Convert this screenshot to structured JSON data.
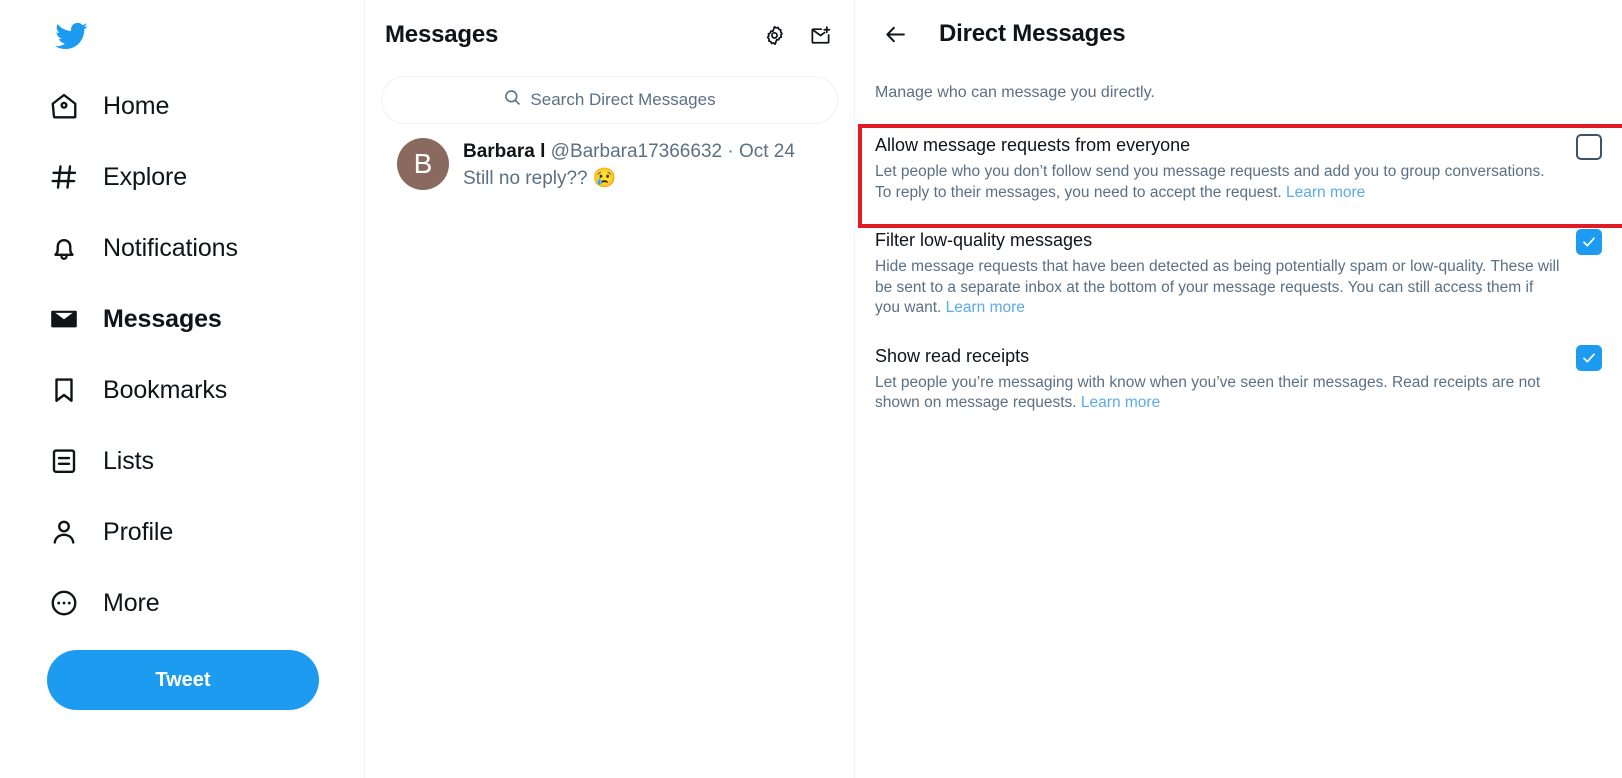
{
  "sidebar": {
    "logo_icon": "twitter-bird-logo",
    "items": [
      {
        "label": "Home",
        "icon": "home-icon",
        "active": false
      },
      {
        "label": "Explore",
        "icon": "hashtag-icon",
        "active": false
      },
      {
        "label": "Notifications",
        "icon": "bell-icon",
        "active": false
      },
      {
        "label": "Messages",
        "icon": "envelope-icon",
        "active": true
      },
      {
        "label": "Bookmarks",
        "icon": "bookmark-icon",
        "active": false
      },
      {
        "label": "Lists",
        "icon": "list-icon",
        "active": false
      },
      {
        "label": "Profile",
        "icon": "person-icon",
        "active": false
      },
      {
        "label": "More",
        "icon": "more-circle-icon",
        "active": false
      }
    ],
    "tweet_button": "Tweet"
  },
  "messages_column": {
    "title": "Messages",
    "settings_icon": "gear-icon",
    "new_message_icon": "new-message-icon",
    "search": {
      "icon": "search-icon",
      "placeholder": "Search Direct Messages",
      "value": ""
    },
    "conversations": [
      {
        "avatar_initial": "B",
        "avatar_color": "#8a6a5e",
        "name": "Barbara l",
        "handle": "@Barbara17366632",
        "separator": "·",
        "date": "Oct 24",
        "preview": "Still no reply?? 😢"
      }
    ]
  },
  "settings_panel": {
    "back_icon": "back-arrow-icon",
    "title": "Direct Messages",
    "subtitle": "Manage who can message you directly.",
    "learn_more_label": "Learn more",
    "settings": [
      {
        "label": "Allow message requests from everyone",
        "description": "Let people who you don’t follow send you message requests and add you to group conversations. To reply to their messages, you need to accept the request. ",
        "checked": false,
        "highlighted": true
      },
      {
        "label": "Filter low-quality messages",
        "description": "Hide message requests that have been detected as being potentially spam or low-quality. These will be sent to a separate inbox at the bottom of your message requests. You can still access them if you want. ",
        "checked": true,
        "highlighted": false
      },
      {
        "label": "Show read receipts",
        "description": "Let people you’re messaging with know when you’ve seen their messages. Read receipts are not shown on message requests. ",
        "checked": true,
        "highlighted": false
      }
    ]
  },
  "colors": {
    "accent": "#1d9bf0",
    "highlight_box": "#e01b24",
    "link": "#5aabe8",
    "muted_text": "#5b7083",
    "primary_text": "#0f1419"
  }
}
